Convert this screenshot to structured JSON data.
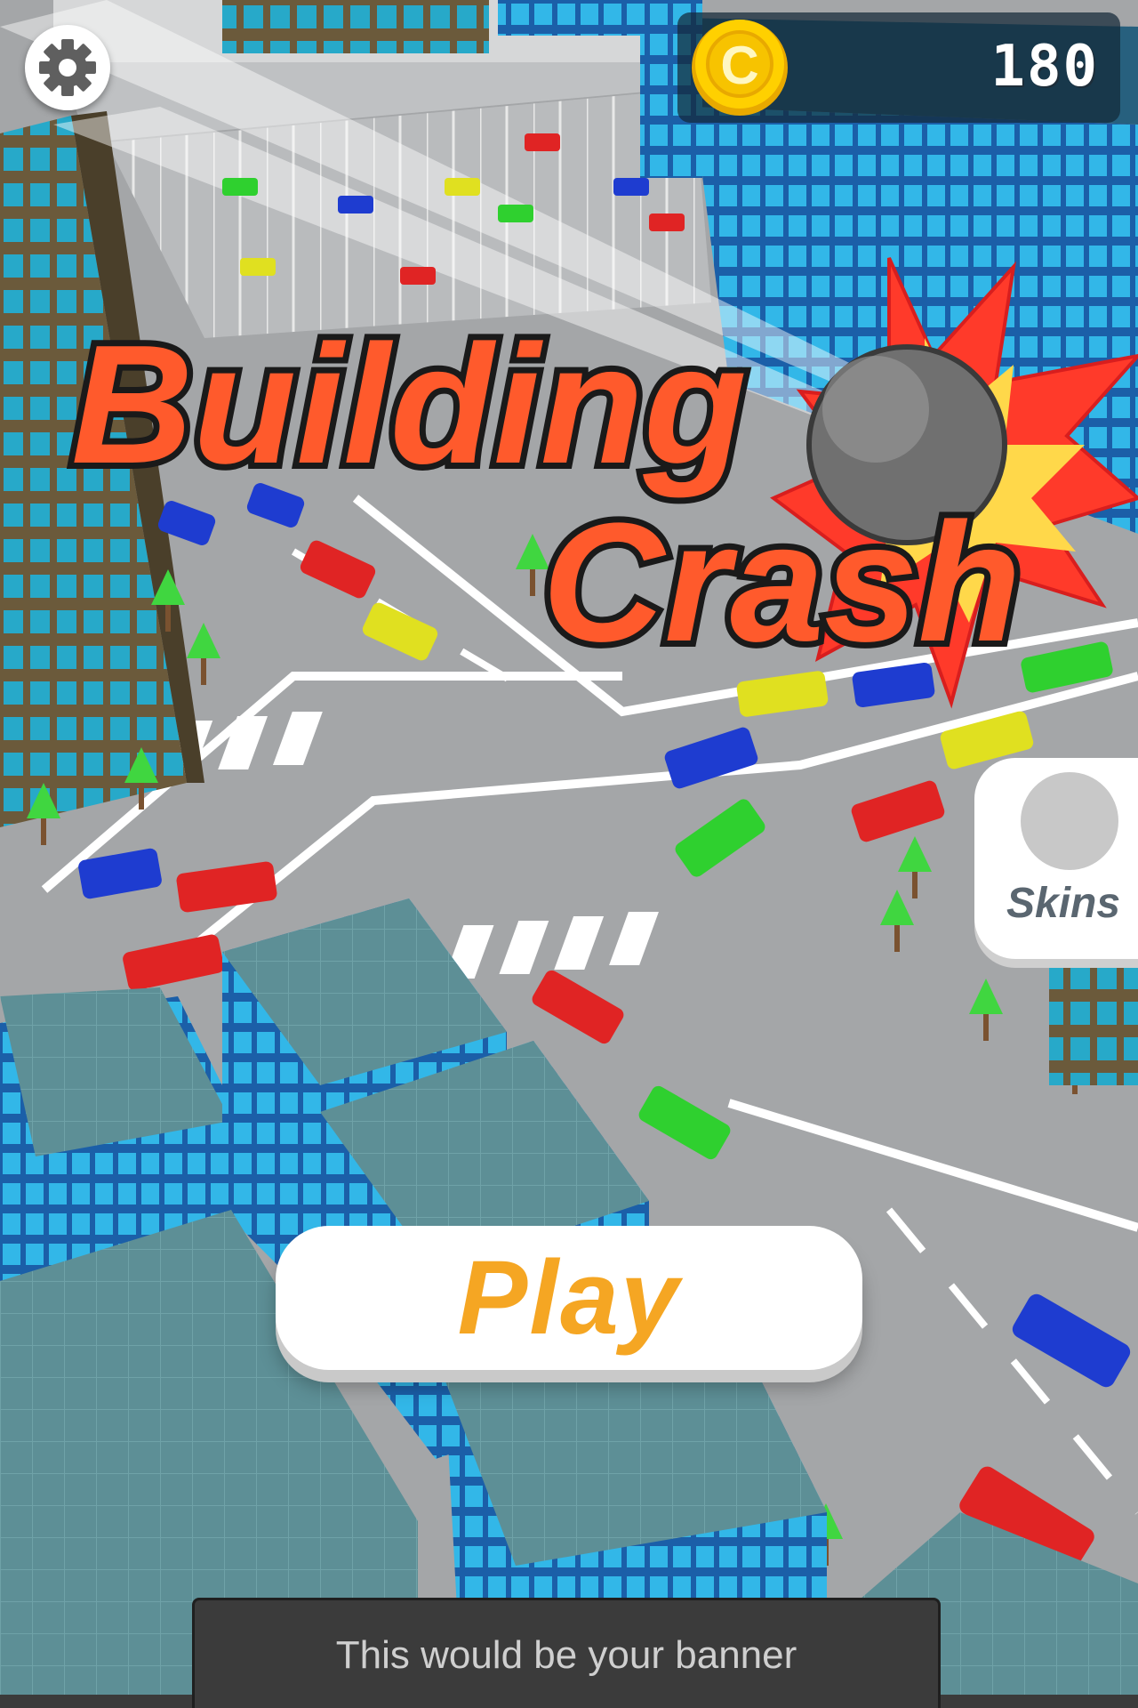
{
  "game": {
    "title_line1": "Building",
    "title_line2": "Crash"
  },
  "hud": {
    "coin_symbol": "C",
    "coin_count": "180",
    "settings_icon": "gear-icon"
  },
  "buttons": {
    "play_label": "Play",
    "skins_label": "Skins"
  },
  "ad": {
    "banner_text": "This would be your banner"
  },
  "colors": {
    "title_fill": "#ff5a2c",
    "play_text": "#f5a623",
    "coin_gold": "#f7c300",
    "road": "#a7a9ab",
    "building_glass": "#2a8fd0"
  }
}
